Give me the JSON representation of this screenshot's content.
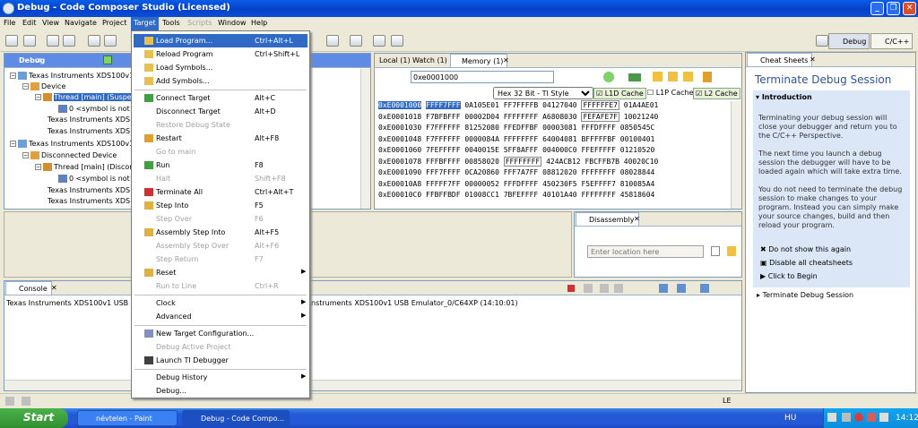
{
  "window": {
    "title": "Debug - Code Composer Studio (Licensed)"
  },
  "menubar": [
    "File",
    "Edit",
    "View",
    "Navigate",
    "Project",
    "Target",
    "Tools",
    "Scripts",
    "Window",
    "Help"
  ],
  "perspectives": {
    "debug": "Debug",
    "cpp": "C/C++"
  },
  "debug_view": {
    "tab": "Debug",
    "tree": [
      "Texas Instruments XDS100v1",
      "Device",
      "Thread [main] (Suspe",
      "0 <symbol is not a",
      "Texas Instruments XDS10",
      "Texas Instruments XDS10",
      "Texas Instruments XDS100v1",
      "Disconnected Device",
      "Thread [main] (Discon",
      "0 <symbol is not a",
      "Texas Instruments XDS10",
      "Texas Instruments XDS10"
    ]
  },
  "memory_view": {
    "tabs": [
      "Local (1)",
      "Watch (1)",
      "Memory (1)"
    ],
    "address_input": "0xe0001000",
    "format_select": "Hex 32 Bit - TI Style",
    "checkboxes": [
      {
        "label": "L1D Cache",
        "checked": true
      },
      {
        "label": "L1P Cache",
        "checked": false
      },
      {
        "label": "L2 Cache",
        "checked": true
      }
    ],
    "rows": [
      {
        "addr": "0xE0001000",
        "vals": [
          "FFFF7FFF",
          "0A105E01",
          "FF7FFFFB",
          "04127040",
          "FFFFFFE7",
          "01A4AE01"
        ]
      },
      {
        "addr": "0xE0001018",
        "vals": [
          "F7BFBFFF",
          "00002D04",
          "FFFFFFFF",
          "A6808030",
          "FEFAFE7F",
          "10021240"
        ]
      },
      {
        "addr": "0xE0001030",
        "vals": [
          "F7FFFFFF",
          "81252080",
          "FFEDFFBF",
          "00003081",
          "FFFDFFFF",
          "0850545C"
        ]
      },
      {
        "addr": "0xE0001048",
        "vals": [
          "F7FFFFFF",
          "0000084A",
          "FFFFFFFF",
          "64004081",
          "BFFFFFBF",
          "00100401"
        ]
      },
      {
        "addr": "0xE0001060",
        "vals": [
          "7FEFFFFF",
          "0040015E",
          "5FF8AFFF",
          "004000C0",
          "FFEFFFFF",
          "01210520"
        ]
      },
      {
        "addr": "0xE0001078",
        "vals": [
          "FFFBFFFF",
          "00858020",
          "FFFFFFFF",
          "424ACB12",
          "FBCFFB7B",
          "40020C10"
        ]
      },
      {
        "addr": "0xE0001090",
        "vals": [
          "FFF7FFFF",
          "0CA20860",
          "FFF7A7FF",
          "08812020",
          "FFFFFFFF",
          "08028844"
        ]
      },
      {
        "addr": "0xE00010A8",
        "vals": [
          "FFFFF7FF",
          "00000052",
          "FFFDFFFF",
          "450230F5",
          "F5EFFFF7",
          "810085A4"
        ]
      },
      {
        "addr": "0xE00010C0",
        "vals": [
          "FFBFFBDF",
          "01008CC1",
          "7BFEFFFF",
          "40101A40",
          "FFFFFFFF",
          "45818604"
        ]
      }
    ]
  },
  "disassembly": {
    "tab": "Disassembly",
    "location_placeholder": "Enter location here"
  },
  "console": {
    "tab": "Console",
    "line_left": "Texas Instruments XDS100v1 USB Emu",
    "line_right": "nstruments XDS100v1 USB Emulator_0/C64XP (14:10:01)"
  },
  "cheat_sheet": {
    "tab": "Cheat Sheets",
    "title": "Terminate Debug Session",
    "section": "Introduction",
    "para1": "Terminating your debug session will close your debugger and return you to the C/C++ Perspective.",
    "para2": "The next time you launch a debug session the debugger will have to be loaded again which will take extra time.",
    "para3": "You do not need to terminate the debug session to make changes to your program. Instead you can simply make your source changes, build and then reload your program.",
    "links": [
      "Do not show this again",
      "Disable all cheatsheets",
      "Click to Begin"
    ],
    "subsection": "Terminate Debug Session"
  },
  "target_menu": {
    "items": [
      {
        "label": "Load Program...",
        "accel": "Ctrl+Alt+L",
        "disabled": false,
        "highlight": true
      },
      {
        "label": "Reload Program",
        "accel": "Ctrl+Shift+L",
        "disabled": false
      },
      {
        "label": "Load Symbols...",
        "accel": "",
        "disabled": false
      },
      {
        "label": "Add Symbols...",
        "accel": "",
        "disabled": false
      },
      {
        "sep": true
      },
      {
        "label": "Connect Target",
        "accel": "Alt+C",
        "disabled": false
      },
      {
        "label": "Disconnect Target",
        "accel": "Alt+D",
        "disabled": false
      },
      {
        "label": "Restore Debug State",
        "accel": "",
        "disabled": true
      },
      {
        "label": "Restart",
        "accel": "Alt+F8",
        "disabled": false
      },
      {
        "label": "Go to main",
        "accel": "",
        "disabled": true
      },
      {
        "label": "Run",
        "accel": "F8",
        "disabled": false
      },
      {
        "label": "Halt",
        "accel": "Shift+F8",
        "disabled": true
      },
      {
        "label": "Terminate All",
        "accel": "Ctrl+Alt+T",
        "disabled": false
      },
      {
        "label": "Step Into",
        "accel": "F5",
        "disabled": false
      },
      {
        "label": "Step Over",
        "accel": "F6",
        "disabled": true
      },
      {
        "label": "Assembly Step Into",
        "accel": "Alt+F5",
        "disabled": false
      },
      {
        "label": "Assembly Step Over",
        "accel": "Alt+F6",
        "disabled": true
      },
      {
        "label": "Step Return",
        "accel": "F7",
        "disabled": true
      },
      {
        "label": "Reset",
        "accel": "",
        "disabled": false,
        "submenu": true
      },
      {
        "label": "Run to Line",
        "accel": "Ctrl+R",
        "disabled": true
      },
      {
        "sep": true
      },
      {
        "label": "Clock",
        "accel": "",
        "disabled": false,
        "submenu": true
      },
      {
        "label": "Advanced",
        "accel": "",
        "disabled": false,
        "submenu": true
      },
      {
        "sep": true
      },
      {
        "label": "New Target Configuration...",
        "accel": "",
        "disabled": false
      },
      {
        "label": "Debug Active Project",
        "accel": "",
        "disabled": true
      },
      {
        "label": "Launch TI Debugger",
        "accel": "",
        "disabled": false
      },
      {
        "sep": true
      },
      {
        "label": "Debug History",
        "accel": "",
        "disabled": false,
        "submenu": true
      },
      {
        "label": "Debug...",
        "accel": "",
        "disabled": false
      }
    ]
  },
  "statusbar": {
    "mode": "LE"
  },
  "taskbar": {
    "start": "Start",
    "tasks": [
      "névtelen - Paint",
      "Debug - Code Compo..."
    ],
    "lang": "HU",
    "clock": "14:12"
  }
}
